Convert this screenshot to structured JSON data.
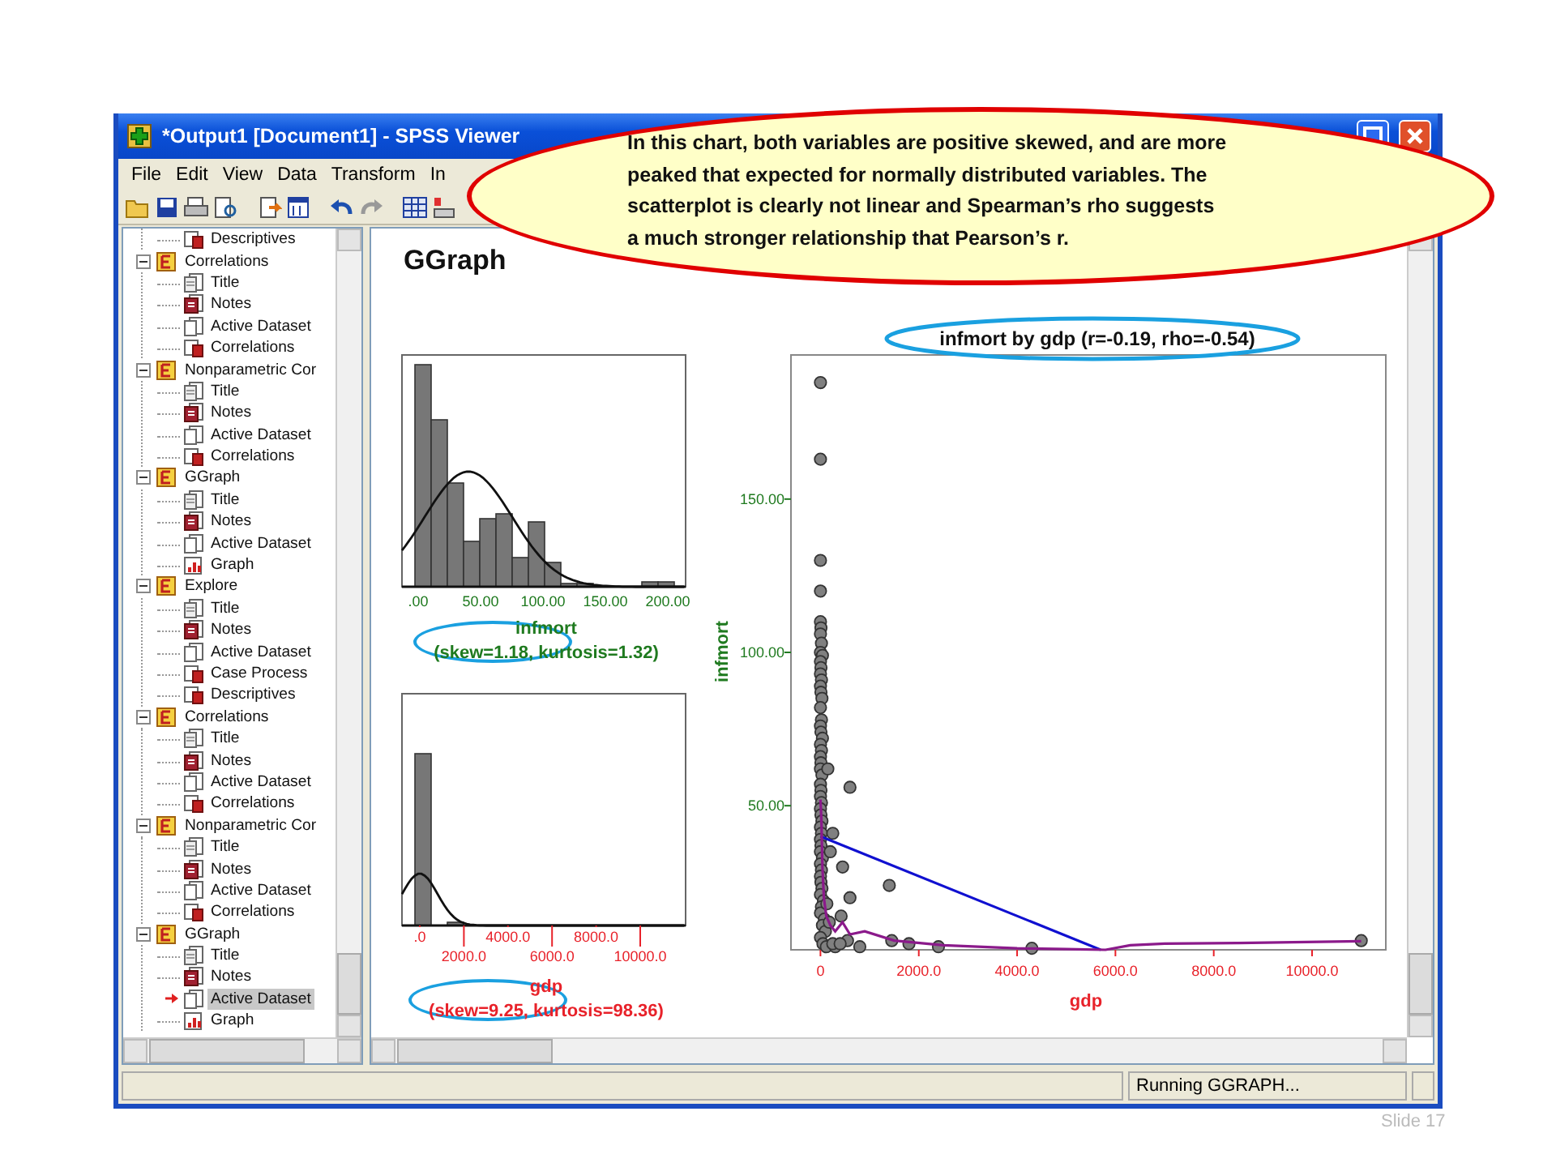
{
  "window": {
    "title": "*Output1 [Document1] - SPSS Viewer"
  },
  "menu": [
    "File",
    "Edit",
    "View",
    "Data",
    "Transform",
    "In"
  ],
  "outline": {
    "continued_children": [
      {
        "label": "Descriptives",
        "kind": "table",
        "selected": false
      }
    ],
    "groups": [
      {
        "label": "Correlations",
        "expanded": true,
        "children": [
          {
            "label": "Title",
            "kind": "title",
            "selected": false
          },
          {
            "label": "Notes",
            "kind": "notes",
            "selected": false
          },
          {
            "label": "Active Dataset",
            "kind": "dataset",
            "selected": false
          },
          {
            "label": "Correlations",
            "kind": "table",
            "selected": false
          }
        ]
      },
      {
        "label": "Nonparametric Cor",
        "expanded": true,
        "children": [
          {
            "label": "Title",
            "kind": "title",
            "selected": false
          },
          {
            "label": "Notes",
            "kind": "notes",
            "selected": false
          },
          {
            "label": "Active Dataset",
            "kind": "dataset",
            "selected": false
          },
          {
            "label": "Correlations",
            "kind": "table",
            "selected": false
          }
        ]
      },
      {
        "label": "GGraph",
        "expanded": true,
        "children": [
          {
            "label": "Title",
            "kind": "title",
            "selected": false
          },
          {
            "label": "Notes",
            "kind": "notes",
            "selected": false
          },
          {
            "label": "Active Dataset",
            "kind": "dataset",
            "selected": false
          },
          {
            "label": "Graph",
            "kind": "graph",
            "selected": false
          }
        ]
      },
      {
        "label": "Explore",
        "expanded": true,
        "children": [
          {
            "label": "Title",
            "kind": "title",
            "selected": false
          },
          {
            "label": "Notes",
            "kind": "notes",
            "selected": false
          },
          {
            "label": "Active Dataset",
            "kind": "dataset",
            "selected": false
          },
          {
            "label": "Case Process",
            "kind": "table",
            "selected": false
          },
          {
            "label": "Descriptives",
            "kind": "table",
            "selected": false
          }
        ]
      },
      {
        "label": "Correlations",
        "expanded": true,
        "children": [
          {
            "label": "Title",
            "kind": "title",
            "selected": false
          },
          {
            "label": "Notes",
            "kind": "notes",
            "selected": false
          },
          {
            "label": "Active Dataset",
            "kind": "dataset",
            "selected": false
          },
          {
            "label": "Correlations",
            "kind": "table",
            "selected": false
          }
        ]
      },
      {
        "label": "Nonparametric Cor",
        "expanded": true,
        "children": [
          {
            "label": "Title",
            "kind": "title",
            "selected": false
          },
          {
            "label": "Notes",
            "kind": "notes",
            "selected": false
          },
          {
            "label": "Active Dataset",
            "kind": "dataset",
            "selected": false
          },
          {
            "label": "Correlations",
            "kind": "table",
            "selected": false
          }
        ]
      },
      {
        "label": "GGraph",
        "expanded": true,
        "children": [
          {
            "label": "Title",
            "kind": "title",
            "selected": false
          },
          {
            "label": "Notes",
            "kind": "notes",
            "selected": false
          },
          {
            "label": "Active Dataset",
            "kind": "dataset",
            "selected": true
          },
          {
            "label": "Graph",
            "kind": "graph",
            "selected": false
          }
        ]
      }
    ]
  },
  "output": {
    "heading": "GGraph",
    "histograms": [
      {
        "color": "#1f7a1f",
        "tick_labels": [
          ".00",
          "50.00",
          "100.00",
          "150.00",
          "200.00"
        ],
        "variable": "infmort",
        "stats": {
          "text": "(skew=1.18, kurtosis=1.32)",
          "highlighted": true
        }
      },
      {
        "color": "#e8222a",
        "tick_labels": [
          ".0",
          "2000.0",
          "4000.0",
          "6000.0",
          "8000.0",
          "10000.0"
        ],
        "variable": "gdp",
        "stats": {
          "text": "(skew=9.25, kurtosis=98.36)",
          "highlighted": true
        }
      }
    ],
    "scatter": {
      "title_highlighted": true,
      "chart_data": {
        "type": "scatter",
        "title": "infmort by gdp (r=-0.19, rho=-0.54)",
        "xlabel": "gdp",
        "ylabel": "infmort",
        "xlim": [
          -600,
          11500
        ],
        "ylim": [
          3,
          197
        ],
        "xticks": [
          {
            "value": 0,
            "label": "0"
          },
          {
            "value": 2000,
            "label": "2000.0"
          },
          {
            "value": 4000,
            "label": "4000.0"
          },
          {
            "value": 6000,
            "label": "6000.0"
          },
          {
            "value": 8000,
            "label": "8000.0"
          },
          {
            "value": 10000,
            "label": "10000.0"
          }
        ],
        "yticks": [
          {
            "value": 50,
            "label": "50.00"
          },
          {
            "value": 100,
            "label": "100.00"
          },
          {
            "value": 150,
            "label": "150.00"
          }
        ],
        "series": [
          {
            "type": "scatter",
            "color": "#808080",
            "x": [
              0,
              0,
              0,
              0,
              0,
              10,
              0,
              20,
              0,
              40,
              0,
              10,
              0,
              20,
              0,
              10,
              30,
              0,
              20,
              0,
              10,
              40,
              0,
              20,
              0,
              10,
              0,
              30,
              0,
              10,
              0,
              20,
              0,
              10,
              30,
              0,
              20,
              0,
              10,
              0,
              40,
              0,
              20,
              0,
              10,
              30,
              0,
              60,
              20,
              0,
              80,
              40,
              100,
              0,
              50,
              120,
              150,
              600,
              250,
              200,
              450,
              1400,
              600,
              420,
              550,
              300,
              800,
              1450,
              1800,
              2400,
              4300,
              11000,
              130,
              180,
              250,
              400
            ],
            "values": [
              188,
              163,
              130,
              120,
              110,
              108,
              106,
              103,
              100,
              99,
              97,
              95,
              93,
              91,
              89,
              87,
              85,
              82,
              78,
              76,
              74,
              72,
              70,
              68,
              66,
              64,
              62,
              60,
              57,
              55,
              53,
              51,
              49,
              47,
              45,
              43,
              41,
              39,
              37,
              35,
              33,
              31,
              29,
              27,
              25,
              23,
              21,
              19,
              17,
              15,
              13,
              11,
              9,
              7,
              5,
              4,
              62,
              56,
              41,
              35,
              30,
              24,
              20,
              14,
              6,
              4,
              4,
              6,
              5,
              4,
              3.5,
              6,
              18,
              12,
              5,
              5
            ]
          },
          {
            "type": "line",
            "color": "#1010d0",
            "x": [
              0,
              5700
            ],
            "values": [
              40,
              3
            ]
          },
          {
            "type": "line",
            "color": "#8b1a8b",
            "x": [
              0,
              20,
              40,
              70,
              120,
              200,
              300,
              450,
              600,
              900,
              1500,
              2500,
              4000,
              5000,
              5800,
              6300,
              7000,
              8500,
              11000
            ],
            "values": [
              52,
              45,
              30,
              20,
              14,
              11,
              9,
              12,
              8,
              9,
              6,
              4.5,
              3.5,
              3.2,
              3,
              4.5,
              5,
              5.2,
              5.8
            ]
          }
        ]
      }
    }
  },
  "callout": {
    "text": "In this chart, both variables are positive skewed, and are more peaked that expected for normally distributed variables. The scatterplot is clearly not linear and Spearman’s rho suggests a much stronger relationship that Pearson’s r."
  },
  "status_bar": {
    "message": "Running GGRAPH..."
  },
  "slide_number": "Slide 17"
}
